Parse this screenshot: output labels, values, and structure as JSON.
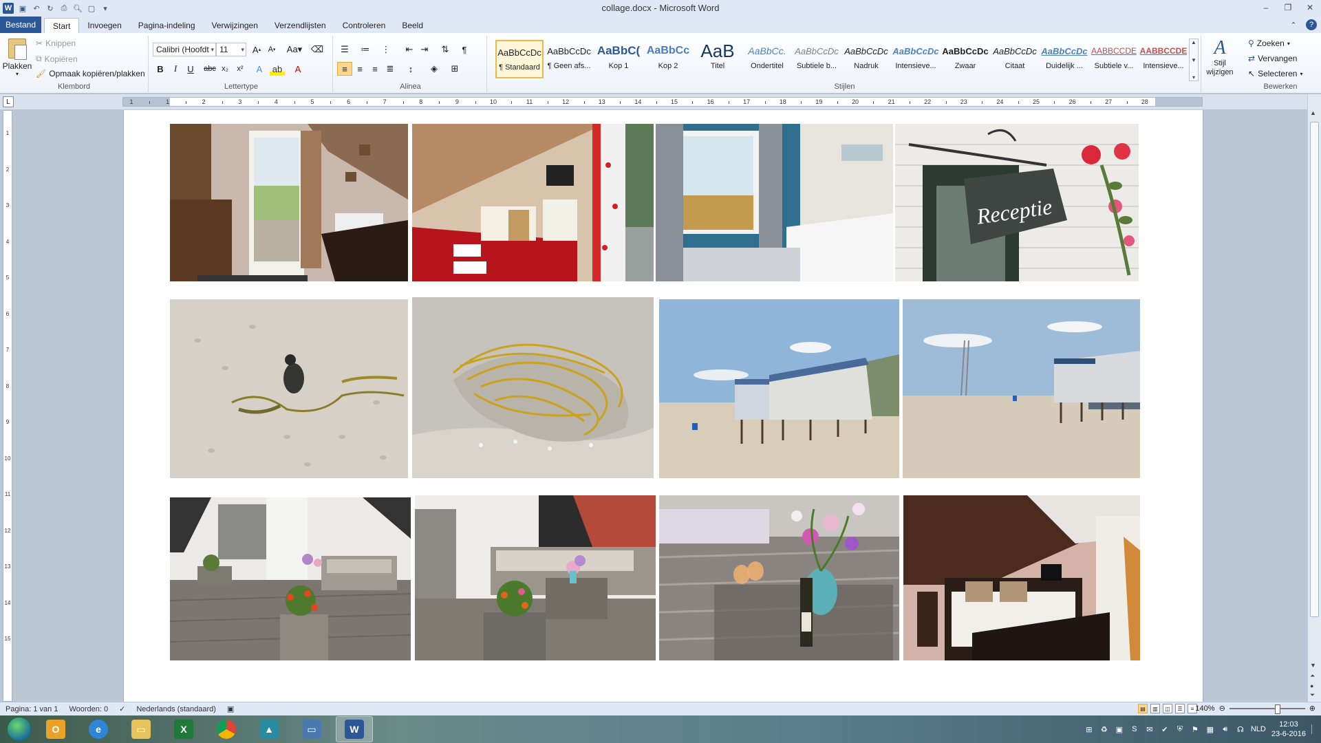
{
  "window": {
    "title": "collage.docx - Microsoft Word"
  },
  "tabs": [
    {
      "label": "Bestand"
    },
    {
      "label": "Start"
    },
    {
      "label": "Invoegen"
    },
    {
      "label": "Pagina-indeling"
    },
    {
      "label": "Verwijzingen"
    },
    {
      "label": "Verzendlijsten"
    },
    {
      "label": "Controleren"
    },
    {
      "label": "Beeld"
    }
  ],
  "clipboard": {
    "paste": "Plakken",
    "cut": "Knippen",
    "copy": "Kopiëren",
    "format_painter": "Opmaak kopiëren/plakken",
    "label": "Klembord"
  },
  "font": {
    "name": "Calibri (Hoofdt",
    "size": "11",
    "label": "Lettertype"
  },
  "paragraph": {
    "label": "Alinea"
  },
  "styles": {
    "label": "Stijlen",
    "items": [
      {
        "sample": "AaBbCcDc",
        "name": "¶ Standaard"
      },
      {
        "sample": "AaBbCcDc",
        "name": "¶ Geen afs..."
      },
      {
        "sample": "AaBbC(",
        "name": "Kop 1"
      },
      {
        "sample": "AaBbCc",
        "name": "Kop 2"
      },
      {
        "sample": "AaB",
        "name": "Titel"
      },
      {
        "sample": "AaBbCc.",
        "name": "Ondertitel"
      },
      {
        "sample": "AaBbCcDc",
        "name": "Subtiele b..."
      },
      {
        "sample": "AaBbCcDc",
        "name": "Nadruk"
      },
      {
        "sample": "AaBbCcDc",
        "name": "Intensieve..."
      },
      {
        "sample": "AaBbCcDc",
        "name": "Zwaar"
      },
      {
        "sample": "AaBbCcDc",
        "name": "Citaat"
      },
      {
        "sample": "AaBbCcDc",
        "name": "Duidelijk ..."
      },
      {
        "sample": "AABBCCDE",
        "name": "Subtiele v..."
      },
      {
        "sample": "AABBCCDE",
        "name": "Intensieve..."
      }
    ],
    "change": "Stijl wijzigen"
  },
  "editing": {
    "find": "Zoeken",
    "replace": "Vervangen",
    "select": "Selecteren",
    "label": "Bewerken"
  },
  "ruler": {
    "numbers": [
      "1",
      "1",
      "2",
      "3",
      "4",
      "5",
      "6",
      "7",
      "8",
      "9",
      "10",
      "11",
      "12",
      "13",
      "14",
      "15",
      "16",
      "17",
      "18",
      "19",
      "20",
      "21",
      "22",
      "23",
      "24",
      "25",
      "26",
      "27",
      "28"
    ]
  },
  "vruler": {
    "numbers": [
      "1",
      "2",
      "3",
      "4",
      "5",
      "6",
      "7",
      "8",
      "9",
      "10",
      "11",
      "12",
      "13",
      "14",
      "15"
    ]
  },
  "photos": {
    "sign_text": "Receptie"
  },
  "status": {
    "page": "Pagina: 1 van 1",
    "words": "Woorden: 0",
    "language": "Nederlands (standaard)",
    "zoom": "140%"
  },
  "taskbar": {
    "lang": "NLD",
    "time": "12:03",
    "date": "23-6-2016"
  },
  "colors": {
    "accent": "#2b5797"
  }
}
